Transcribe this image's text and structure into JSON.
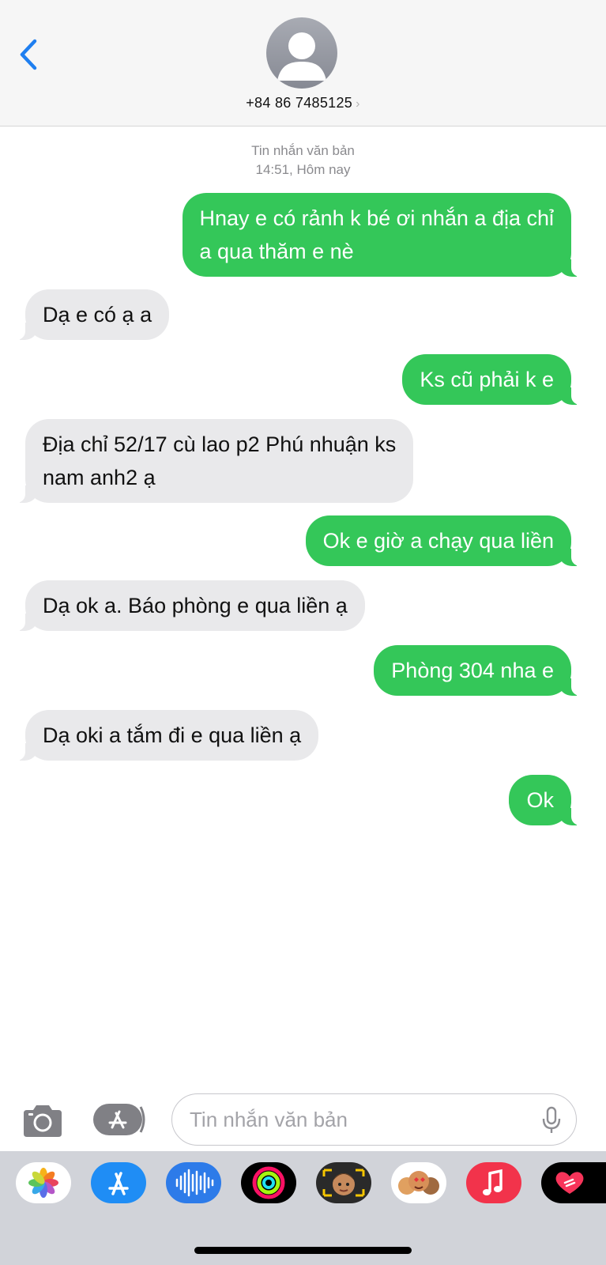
{
  "header": {
    "contact_number": "+84 86 7485125",
    "chevron": "›"
  },
  "thread": {
    "service_label": "Tin nhắn văn bản",
    "timestamp": "14:51, Hôm nay"
  },
  "messages": [
    {
      "direction": "outgoing",
      "lines": [
        "Hnay e có rảnh k bé ơi nhắn a địa chỉ",
        "a qua thăm e nè"
      ]
    },
    {
      "direction": "incoming",
      "lines": [
        "Dạ e có ạ a"
      ]
    },
    {
      "direction": "outgoing",
      "lines": [
        "Ks cũ phải k e"
      ]
    },
    {
      "direction": "incoming",
      "lines": [
        "Địa chỉ 52/17 cù lao p2 Phú nhuận ks",
        "nam anh2 ạ"
      ]
    },
    {
      "direction": "outgoing",
      "lines": [
        "Ok e giờ a chạy qua liền"
      ]
    },
    {
      "direction": "incoming",
      "lines": [
        "Dạ ok a. Báo phòng e qua liền ạ"
      ]
    },
    {
      "direction": "outgoing",
      "lines": [
        "Phòng 304 nha e"
      ]
    },
    {
      "direction": "incoming",
      "lines": [
        "Dạ oki a tắm đi e qua liền ạ"
      ]
    },
    {
      "direction": "outgoing",
      "lines": [
        "Ok"
      ]
    }
  ],
  "composer": {
    "placeholder": "Tin nhắn văn bản",
    "value": ""
  },
  "app_tray": [
    {
      "icon": "photos-icon"
    },
    {
      "icon": "app-store-icon"
    },
    {
      "icon": "audio-message-icon"
    },
    {
      "icon": "activity-icon"
    },
    {
      "icon": "memoji-icon"
    },
    {
      "icon": "memoji-stickers-icon"
    },
    {
      "icon": "music-icon"
    },
    {
      "icon": "digital-touch-icon"
    }
  ],
  "colors": {
    "outgoing_bubble": "#34c759",
    "incoming_bubble": "#e9e9eb",
    "accent": "#1f7ff0",
    "header_bg": "#f6f6f6",
    "tray_bg": "#d1d3d9"
  }
}
